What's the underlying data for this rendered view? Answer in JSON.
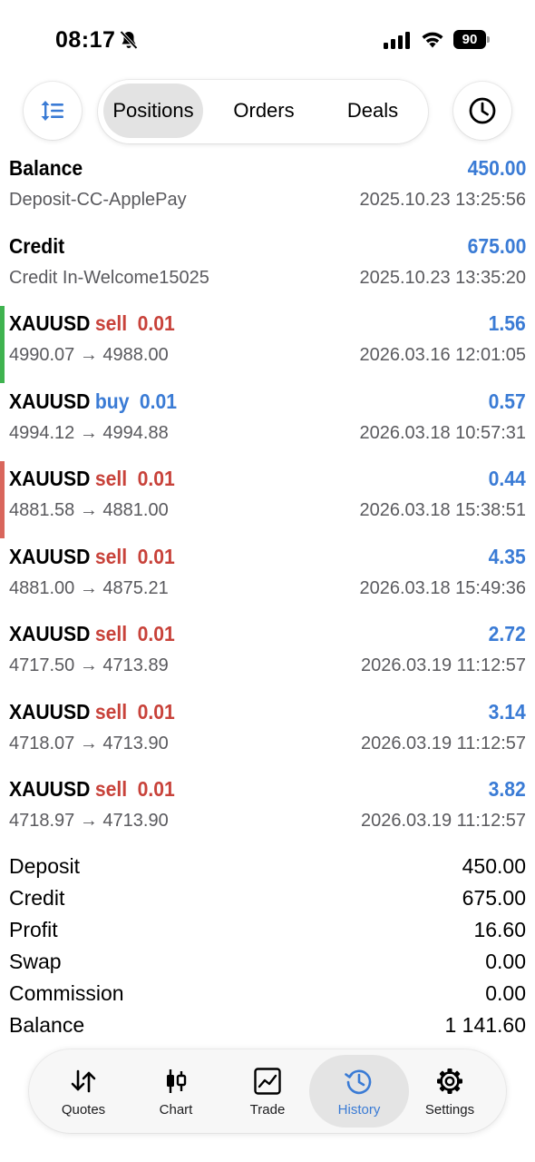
{
  "status_bar": {
    "time": "08:17",
    "battery": "90"
  },
  "top_nav": {
    "tabs": [
      "Positions",
      "Orders",
      "Deals"
    ],
    "active_tab": "Positions"
  },
  "colors": {
    "accent_blue": "#3a7bd5",
    "sell_red": "#c8423a",
    "profit_marker_green": "#3fb34f",
    "loss_marker_red": "#d9665c"
  },
  "deals": [
    {
      "title": "Balance",
      "value": "450.00",
      "subtitle": "Deposit-CC-ApplePay",
      "time": "2025.10.23 13:25:56"
    },
    {
      "title": "Credit",
      "value": "675.00",
      "subtitle": "Credit In-Welcome15025",
      "time": "2025.10.23 13:35:20"
    },
    {
      "symbol": "XAUUSD",
      "side": "sell",
      "volume": "0.01",
      "value": "1.56",
      "prices": "4990.07 → 4988.00",
      "time": "2026.03.16 12:01:05",
      "marker": "green"
    },
    {
      "symbol": "XAUUSD",
      "side": "buy",
      "volume": "0.01",
      "value": "0.57",
      "prices": "4994.12 → 4994.88",
      "time": "2026.03.18 10:57:31"
    },
    {
      "symbol": "XAUUSD",
      "side": "sell",
      "volume": "0.01",
      "value": "0.44",
      "prices": "4881.58 → 4881.00",
      "time": "2026.03.18 15:38:51",
      "marker": "red"
    },
    {
      "symbol": "XAUUSD",
      "side": "sell",
      "volume": "0.01",
      "value": "4.35",
      "prices": "4881.00 → 4875.21",
      "time": "2026.03.18 15:49:36"
    },
    {
      "symbol": "XAUUSD",
      "side": "sell",
      "volume": "0.01",
      "value": "2.72",
      "prices": "4717.50 → 4713.89",
      "time": "2026.03.19 11:12:57"
    },
    {
      "symbol": "XAUUSD",
      "side": "sell",
      "volume": "0.01",
      "value": "3.14",
      "prices": "4718.07 → 4713.90",
      "time": "2026.03.19 11:12:57"
    },
    {
      "symbol": "XAUUSD",
      "side": "sell",
      "volume": "0.01",
      "value": "3.82",
      "prices": "4718.97 → 4713.90",
      "time": "2026.03.19 11:12:57"
    }
  ],
  "summary": [
    {
      "label": "Deposit",
      "value": "450.00"
    },
    {
      "label": "Credit",
      "value": "675.00"
    },
    {
      "label": "Profit",
      "value": "16.60"
    },
    {
      "label": "Swap",
      "value": "0.00"
    },
    {
      "label": "Commission",
      "value": "0.00"
    },
    {
      "label": "Balance",
      "value": "1 141.60"
    }
  ],
  "tab_bar": {
    "tabs": [
      {
        "label": "Quotes",
        "icon": "quotes-icon"
      },
      {
        "label": "Chart",
        "icon": "chart-candles-icon"
      },
      {
        "label": "Trade",
        "icon": "trade-icon"
      },
      {
        "label": "History",
        "icon": "history-icon"
      },
      {
        "label": "Settings",
        "icon": "gear-icon"
      }
    ],
    "active": "History"
  }
}
